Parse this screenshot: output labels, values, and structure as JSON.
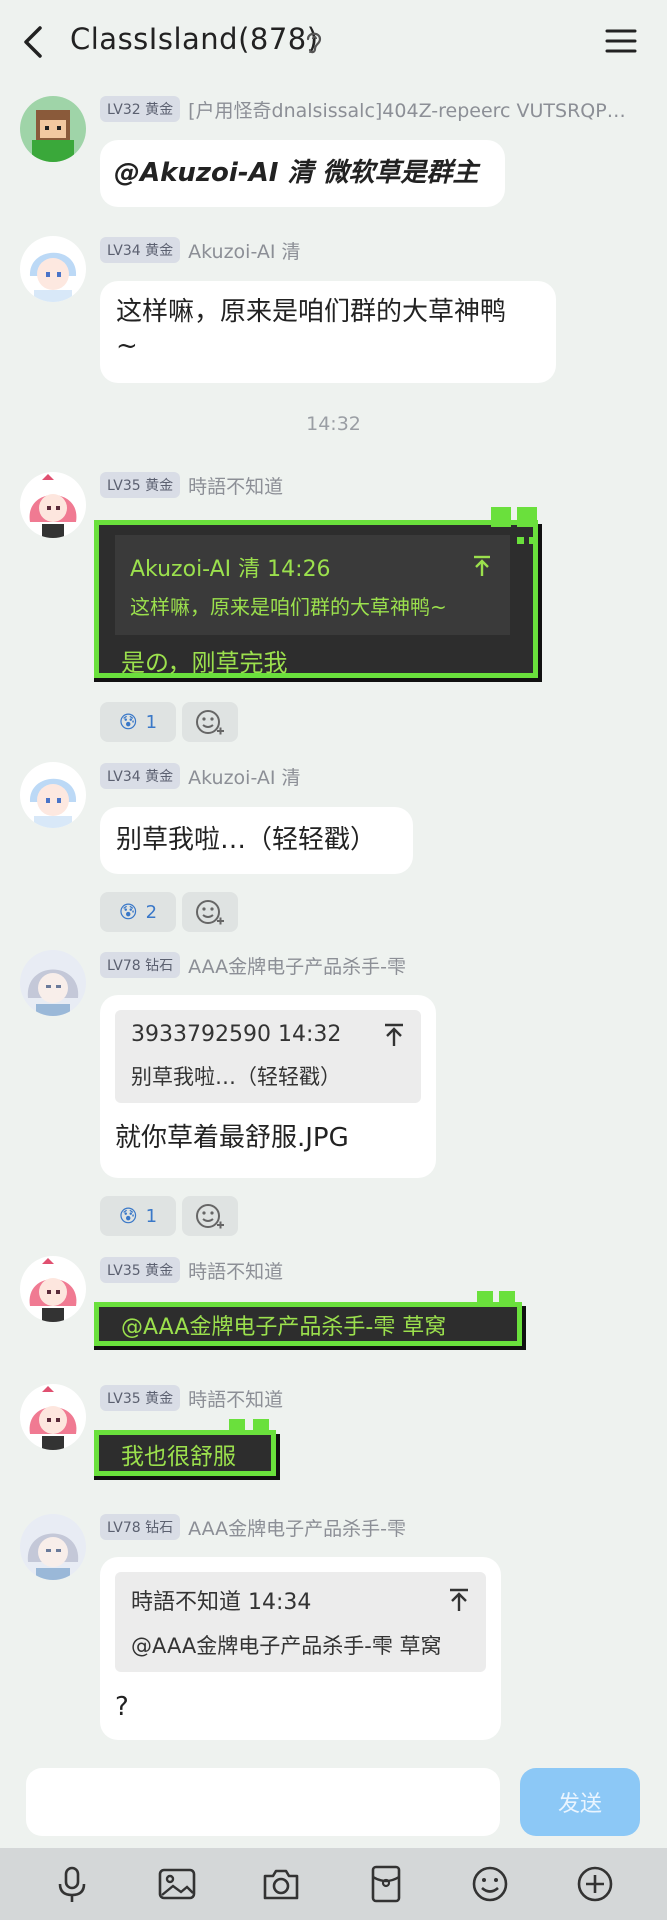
{
  "header": {
    "title": "ClassIsland(878)"
  },
  "messages": [
    {
      "badge": "LV32 黄金",
      "name": "[户用怪奇dnalsissalc]404Z-repeerc VUTSRQP…",
      "text": "@Akuzoi-AI 清 微软草是群主"
    },
    {
      "badge": "LV34 黄金",
      "name": "Akuzoi-AI 清",
      "text1": "这样嘛，原来是咱们群的大草神鸭",
      "text2": "~"
    },
    {
      "badge": "LV35 黄金",
      "name": "時語不知道",
      "quote_head": "Akuzoi-AI 清 14:26",
      "quote_text": "这样嘛，原来是咱们群的大草神鸭~",
      "text": "是の，刚草完我"
    },
    {
      "badge": "LV34 黄金",
      "name": "Akuzoi-AI 清",
      "text": "别草我啦…（轻轻戳）"
    },
    {
      "badge": "LV78 钻石",
      "name": "AAA金牌电子产品杀手-雫",
      "quote_head": "3933792590 14:32",
      "quote_text": "别草我啦…（轻轻戳）",
      "text": "就你草着最舒服.JPG"
    },
    {
      "badge": "LV35 黄金",
      "name": "時語不知道",
      "text": "@AAA金牌电子产品杀手-雫 草窝"
    },
    {
      "badge": "LV35 黄金",
      "name": "時語不知道",
      "text": "我也很舒服"
    },
    {
      "badge": "LV78 钻石",
      "name": "AAA金牌电子产品杀手-雫",
      "quote_head": "時語不知道 14:34",
      "quote_text": "@AAA金牌电子产品杀手-雫 草窝",
      "text": "?"
    }
  ],
  "timestamp": "14:32",
  "reactions": [
    {
      "emoji": "😰",
      "count": "1"
    },
    {
      "emoji": "😰",
      "count": "2"
    },
    {
      "emoji": "😰",
      "count": "1"
    }
  ],
  "composer": {
    "send_label": "发送",
    "placeholder": ""
  },
  "icons": {
    "back": "back-icon",
    "ear": "ear-icon",
    "menu": "menu-icon",
    "toolbar": [
      "microphone-icon",
      "image-icon",
      "camera-icon",
      "red-packet-icon",
      "emoji-icon",
      "plus-icon"
    ]
  },
  "colors": {
    "background": "#eef2ef",
    "bubble": "#ffffff",
    "pixel_green": "#6ae03c",
    "send": "#8cc8f6",
    "reaction_text": "#3a78c8"
  }
}
